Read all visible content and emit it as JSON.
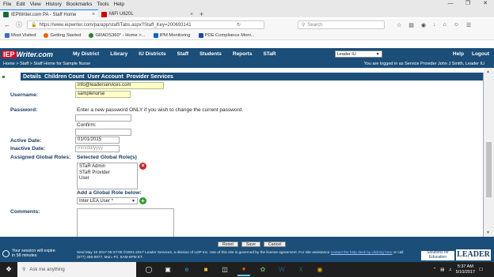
{
  "browser": {
    "menu": [
      "File",
      "Edit",
      "View",
      "History",
      "Bookmarks",
      "Tools",
      "Help"
    ],
    "tabs": [
      {
        "title": "IEPWriter.com PA - Staff Home",
        "active": true
      },
      {
        "title": "MiFi U620L",
        "active": false
      }
    ],
    "url": "https://www.iepwriter.com/pa/app/staff/Tabs.aspx?Staff_Key=200693141",
    "search_placeholder": "Search",
    "bookmarks": [
      "Most Visited",
      "Getting Started",
      "GRADS360° - Home >...",
      "IPM Monitoring",
      "PDE Compliance Moni..."
    ]
  },
  "app": {
    "logo": {
      "part1": "IEP",
      "part2": "Writer.com"
    },
    "nav": [
      "My District",
      "Library",
      "IU Districts",
      "Staff",
      "Students",
      "Reports",
      "STaR"
    ],
    "lea_select": "Leader IU",
    "right_nav": [
      "Help",
      "Logout"
    ],
    "breadcrumb": "Home > Staff > Staff Home for Sample Nurse",
    "logged_in": "You are logged in as  Service Provider John J Smith, Leader IU",
    "tabs": [
      "Details",
      "Children Count",
      "User Account",
      "Provider Services"
    ]
  },
  "form": {
    "email_value": "info@leaderservices.com",
    "username_label": "Username:",
    "username_value": "samplenurse",
    "password_label": "Password:",
    "password_hint": "Enter a new password ONLY if you wish to change the current password.",
    "confirm_label": "Confirm:",
    "active_date_label": "Active Date:",
    "active_date_value": "01/01/2015",
    "inactive_date_label": "Inactive Date:",
    "inactive_date_placeholder": "mm/dd/yyyy",
    "assigned_roles_label": "Assigned Global Roles:",
    "selected_roles_label": "Selected Global Role(s)",
    "selected_roles": [
      "STaR Admin",
      "STaR Provider",
      "User"
    ],
    "add_role_label": "Add a Global Role below:",
    "add_role_value": "Inter LEA User *",
    "comments_label": "Comments:"
  },
  "footer": {
    "session_warning": "Your session will expire in 58 minutes",
    "buttons": [
      "Reset",
      "Save",
      "Cancel"
    ],
    "copyright": "Wed May 10 2017 05:37:05 ©2001-2017 Leader Services, a division of LDP Inc. Use of this site is governed by the license agreement. For site assistance",
    "help_link": "contact the help desk by clicking here",
    "contact": " or call (877) 456-8977, Mon.-Fri. 8AM-6PM ET.",
    "solutions": "Solutions for Education",
    "leader_logo": "LEADER"
  },
  "taskbar": {
    "search_placeholder": "Ask me anything",
    "time": "5:37 AM",
    "date": "5/10/2017"
  },
  "colors": {
    "brand_navy": "#1b4e78",
    "input_highlight": "#ffffc8",
    "delete_red": "#c62828",
    "add_green": "#2e9a2e"
  }
}
